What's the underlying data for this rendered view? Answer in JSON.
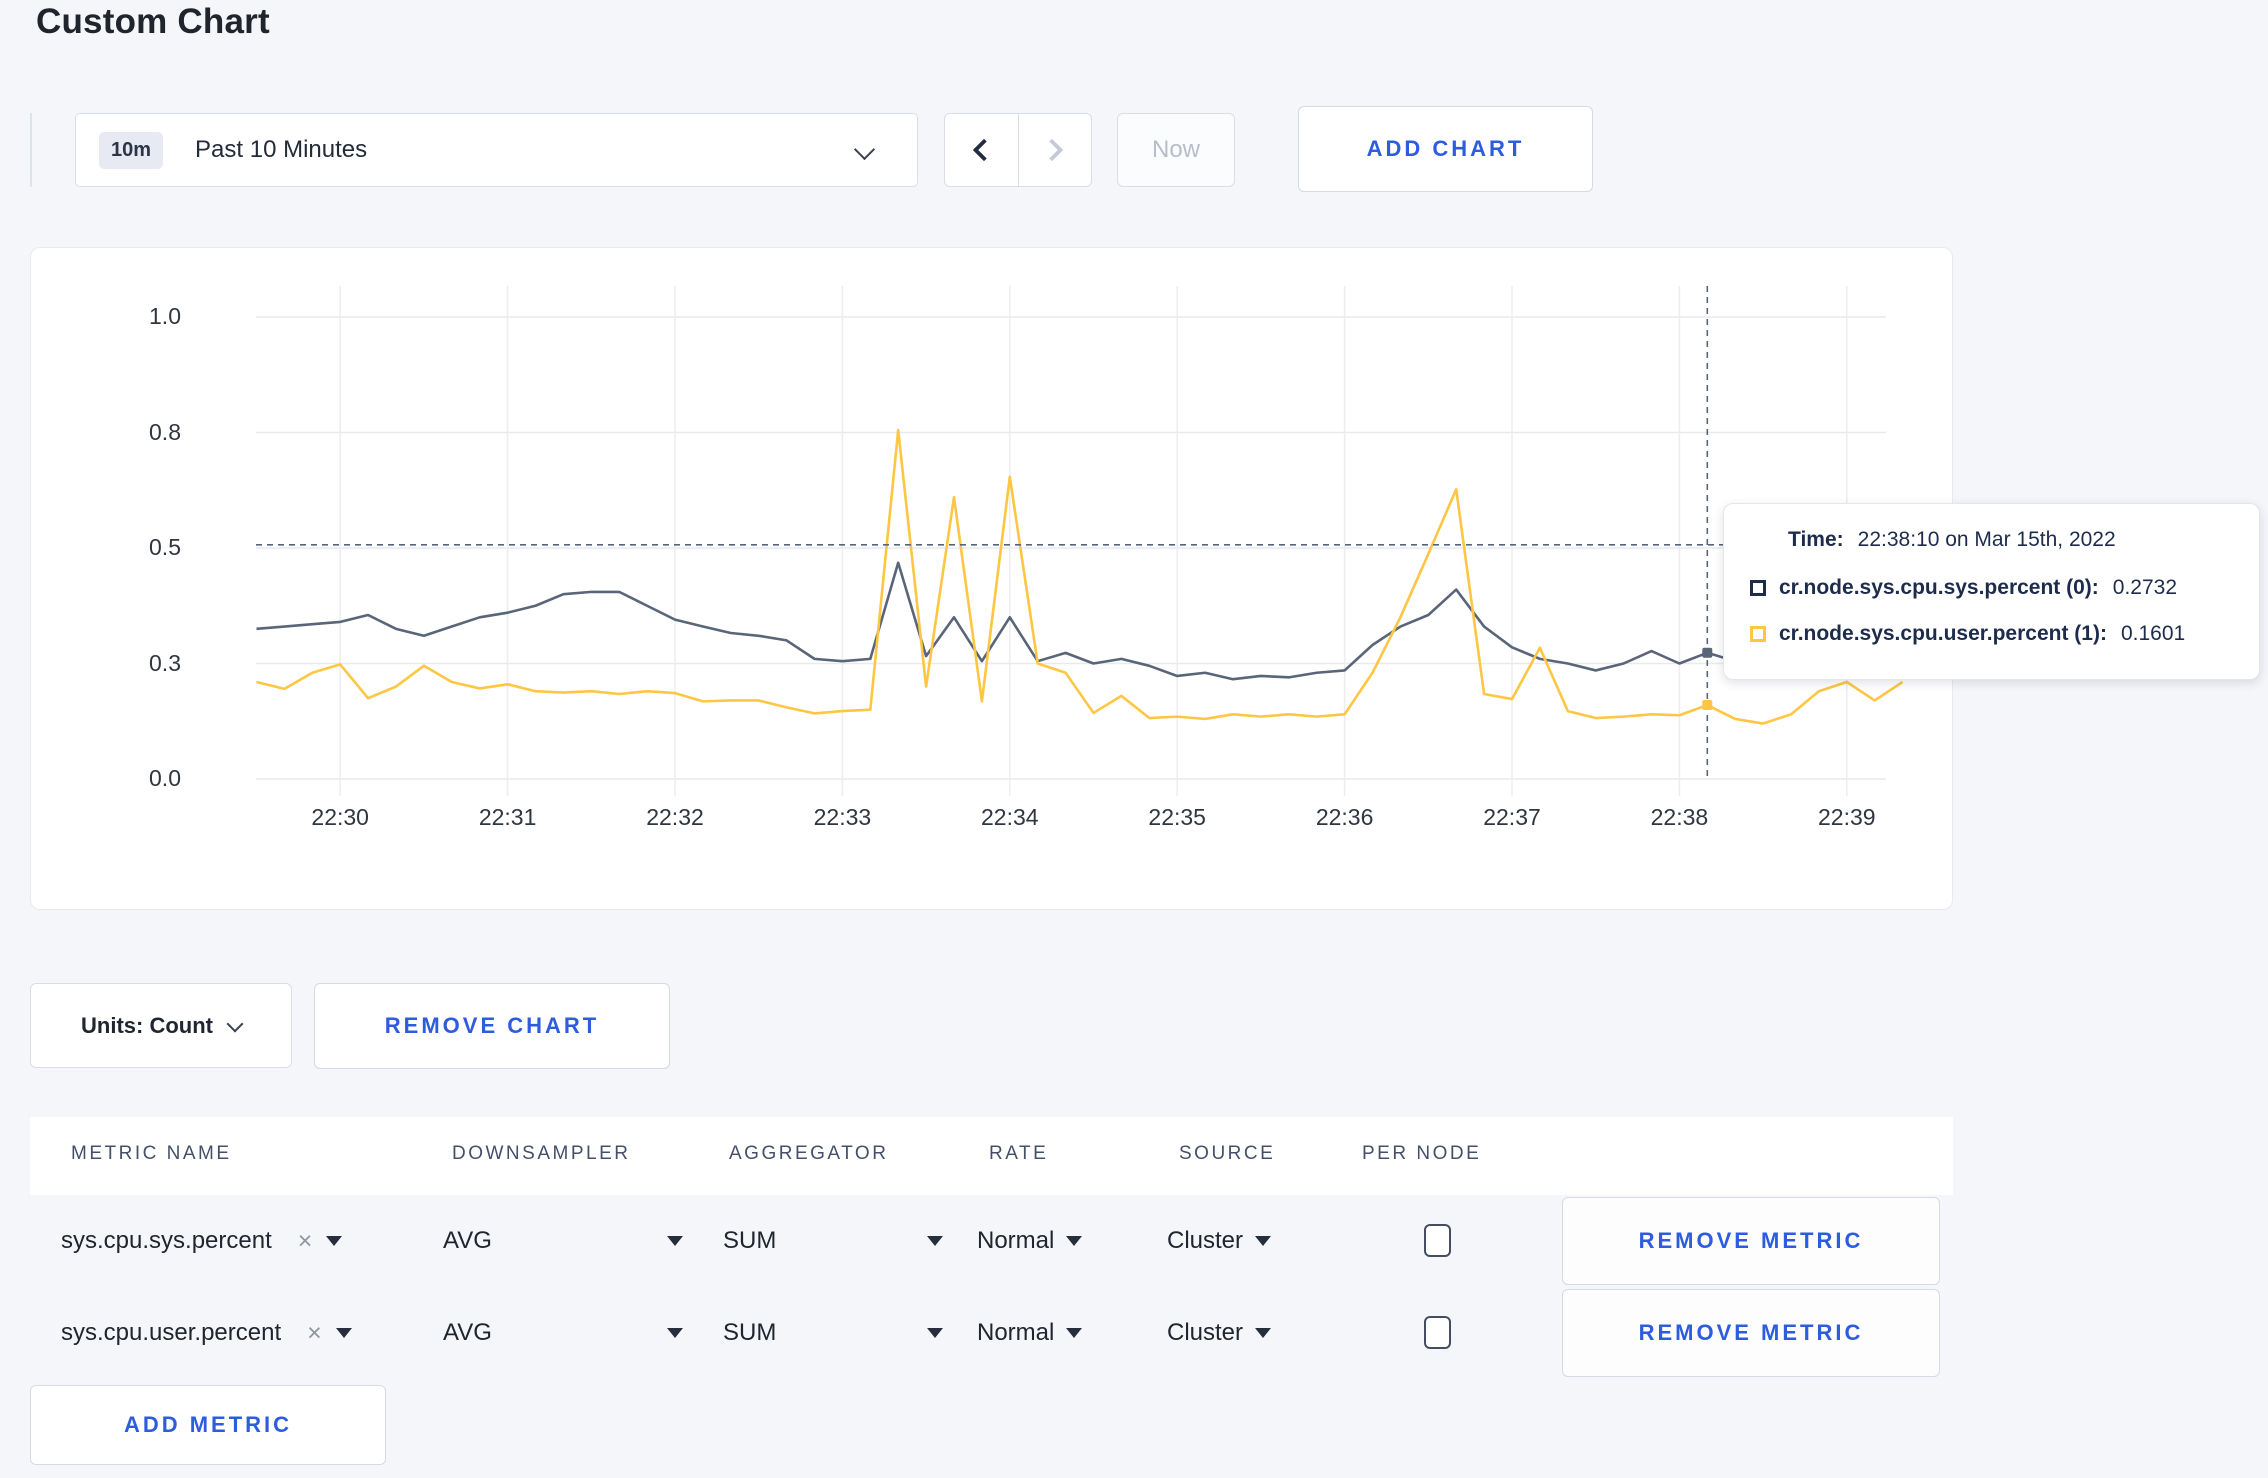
{
  "page": {
    "title": "Custom Chart",
    "background": "#f4f6f9",
    "accent_blue": "#2d5cde"
  },
  "toolbar": {
    "time_range_badge": "10m",
    "time_range_label": "Past 10 Minutes",
    "now_label": "Now",
    "add_chart_label": "ADD CHART"
  },
  "chart_data": {
    "type": "line",
    "title": "",
    "xlabel": "",
    "ylabel": "",
    "ylim": [
      0,
      1
    ],
    "grid": true,
    "y_tick_values": [
      0,
      0.25,
      0.5,
      0.75,
      1.0
    ],
    "y_tick_labels": [
      "0.0",
      "0.3",
      "0.5",
      "0.8",
      "1.0"
    ],
    "x_tick_labels": [
      "22:30",
      "22:31",
      "22:32",
      "22:33",
      "22:34",
      "22:35",
      "22:36",
      "22:37",
      "22:38",
      "22:39"
    ],
    "x_start_time": "22:29:30",
    "x_step_seconds": 10,
    "x_tick_start_index": 3,
    "x_tick_step": 6,
    "series": [
      {
        "name": "cr.node.sys.cpu.sys.percent",
        "color": "#5a6579",
        "values": [
          0.325,
          0.33,
          0.335,
          0.34,
          0.355,
          0.325,
          0.31,
          0.33,
          0.35,
          0.36,
          0.375,
          0.4,
          0.405,
          0.405,
          0.375,
          0.345,
          0.33,
          0.316,
          0.31,
          0.3,
          0.26,
          0.255,
          0.26,
          0.468,
          0.266,
          0.35,
          0.255,
          0.35,
          0.255,
          0.273,
          0.25,
          0.26,
          0.245,
          0.223,
          0.23,
          0.216,
          0.223,
          0.22,
          0.23,
          0.235,
          0.29,
          0.33,
          0.355,
          0.41,
          0.33,
          0.285,
          0.26,
          0.25,
          0.235,
          0.25,
          0.277,
          0.25,
          0.2732,
          0.255,
          0.26,
          0.255,
          0.26,
          0.265,
          0.255,
          0.26
        ]
      },
      {
        "name": "cr.node.sys.cpu.user.percent",
        "color": "#fec643",
        "values": [
          0.21,
          0.195,
          0.23,
          0.248,
          0.175,
          0.2,
          0.245,
          0.21,
          0.196,
          0.205,
          0.19,
          0.187,
          0.19,
          0.184,
          0.19,
          0.186,
          0.168,
          0.17,
          0.17,
          0.155,
          0.142,
          0.147,
          0.15,
          0.755,
          0.2,
          0.61,
          0.168,
          0.654,
          0.25,
          0.23,
          0.143,
          0.18,
          0.132,
          0.135,
          0.13,
          0.14,
          0.135,
          0.14,
          0.135,
          0.14,
          0.23,
          0.35,
          0.487,
          0.627,
          0.184,
          0.173,
          0.284,
          0.147,
          0.132,
          0.135,
          0.14,
          0.138,
          0.1601,
          0.13,
          0.12,
          0.14,
          0.19,
          0.21,
          0.17,
          0.21
        ]
      }
    ],
    "hover": {
      "index": 52,
      "y_value": 0.507
    },
    "legend_position": "tooltip"
  },
  "tooltip": {
    "time_label": "Time:",
    "time_value": "22:38:10 on Mar 15th, 2022",
    "rows": [
      {
        "label": "cr.node.sys.cpu.sys.percent (0):",
        "value": "0.2732",
        "color": "#1d2c4c"
      },
      {
        "label": "cr.node.sys.cpu.user.percent (1):",
        "value": "0.1601",
        "color": "#fec643"
      }
    ]
  },
  "chart_controls": {
    "units_label": "Units: Count",
    "remove_chart_label": "REMOVE CHART"
  },
  "metrics_table": {
    "headers": [
      "METRIC NAME",
      "DOWNSAMPLER",
      "AGGREGATOR",
      "RATE",
      "SOURCE",
      "PER NODE"
    ],
    "rows": [
      {
        "metric": "sys.cpu.sys.percent",
        "remove_icon": "×",
        "downsampler": "AVG",
        "aggregator": "SUM",
        "rate": "Normal",
        "source": "Cluster",
        "per_node_checked": false,
        "remove_label": "REMOVE METRIC"
      },
      {
        "metric": "sys.cpu.user.percent",
        "remove_icon": "×",
        "downsampler": "AVG",
        "aggregator": "SUM",
        "rate": "Normal",
        "source": "Cluster",
        "per_node_checked": false,
        "remove_label": "REMOVE METRIC"
      }
    ],
    "add_metric_label": "ADD METRIC"
  }
}
